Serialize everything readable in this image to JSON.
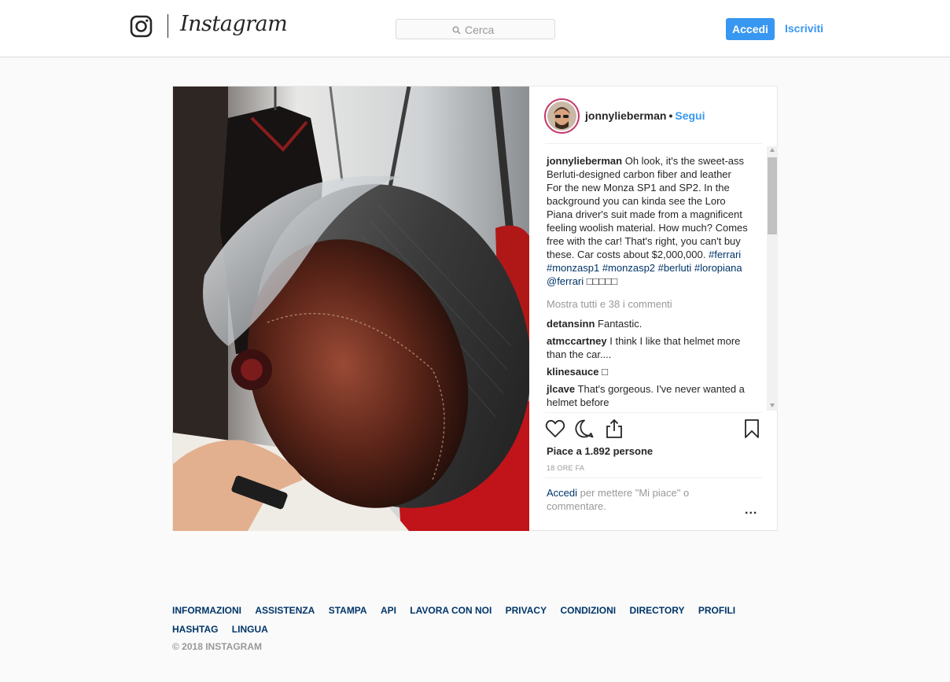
{
  "header": {
    "logo_wordmark": "Instagram",
    "search_placeholder": "Cerca",
    "login_label": "Accedi",
    "signup_label": "Iscriviti",
    "accent_color": "#3897f0"
  },
  "post": {
    "username": "jonnylieberman",
    "separator": "•",
    "follow_label": "Segui",
    "caption_text": "Oh look, it's the sweet-ass Berluti-designed carbon fiber and leather For the new Monza SP1 and SP2. In the background you can kinda see the Loro Piana driver's suit made from a magnificent feeling woolish material. How much? Comes free with the car! That's right, you can't buy these. Car costs about $2,000,000.",
    "caption_tags": "#ferrari #monzasp1 #monzasp2 #berluti #loropiana @ferrari",
    "caption_emoji": "□□□□□",
    "view_all_comments": "Mostra tutti e 38 i commenti",
    "comments": [
      {
        "user": "detansinn",
        "text": "Fantastic."
      },
      {
        "user": "atmccartney",
        "text": "I think I like that helmet more than the car...."
      },
      {
        "user": "klinesauce",
        "text": "□"
      },
      {
        "user": "jlcave",
        "text": "That's gorgeous. I've never wanted a helmet before"
      }
    ],
    "likes_text": "Piace a 1.892 persone",
    "time_ago": "18 ORE FA",
    "login_link": "Accedi",
    "login_prompt_rest": "per mettere \"Mi piace\" o commentare.",
    "more_options": "..."
  },
  "footer": {
    "links": [
      "INFORMAZIONI",
      "ASSISTENZA",
      "STAMPA",
      "API",
      "LAVORA CON NOI",
      "PRIVACY",
      "CONDIZIONI",
      "DIRECTORY",
      "PROFILI",
      "HASHTAG",
      "LINGUA"
    ],
    "copyright": "© 2018 INSTAGRAM"
  }
}
